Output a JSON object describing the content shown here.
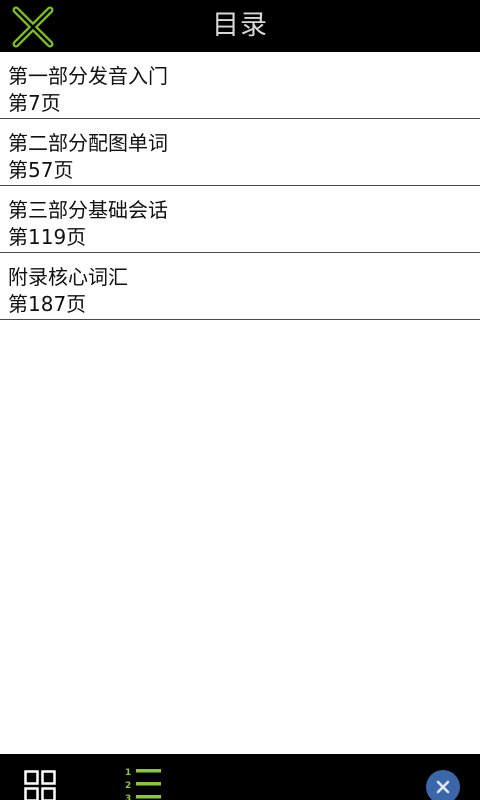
{
  "header": {
    "title": "目录",
    "close_icon": "close-x-icon",
    "accent_color": "#7fbf2a"
  },
  "toc": {
    "items": [
      {
        "title": "第一部分发音入门",
        "page": "第7页"
      },
      {
        "title": "第二部分配图单词",
        "page": "第57页"
      },
      {
        "title": "第三部分基础会话",
        "page": "第119页"
      },
      {
        "title": "附录核心词汇",
        "page": "第187页"
      }
    ]
  },
  "bottom_bar": {
    "grid_icon": "grid-view-icon",
    "list_icon": "numbered-list-icon",
    "list_numbers": [
      "1",
      "2",
      "3"
    ],
    "hide_icon": "close-circle-icon",
    "hide_color": "#3b67a8"
  }
}
